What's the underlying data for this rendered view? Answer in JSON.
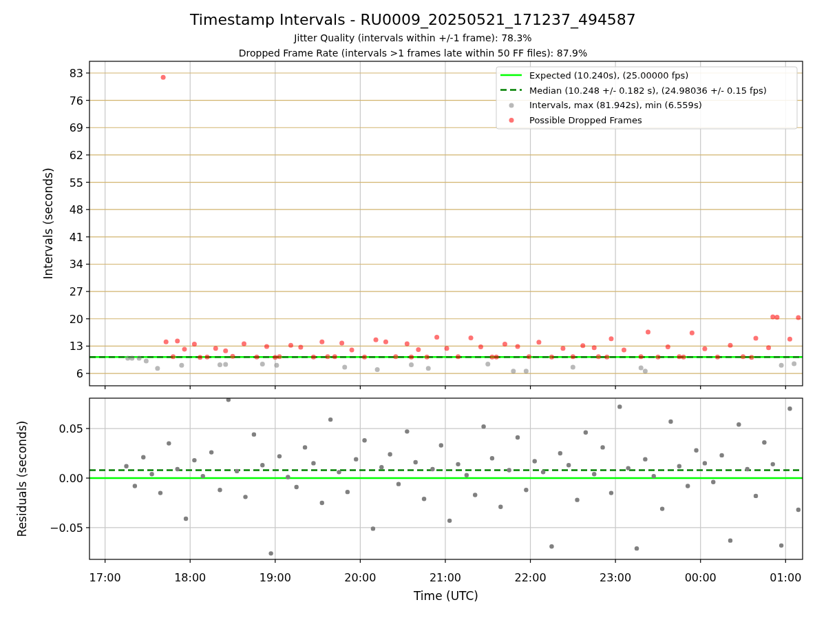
{
  "figure": {
    "title": "Timestamp Intervals - RU0009_20250521_171237_494587",
    "subtitles": [
      "Jitter Quality (intervals within +/-1 frame): 78.3%",
      "Dropped Frame Rate (intervals >1 frames late within 50 FF files): 87.9%"
    ]
  },
  "intervals_panel": {
    "chart_data": {
      "type": "scatter",
      "ylabel": "Intervals (seconds)",
      "xlim": [
        "2025-05-21 16:49",
        "2025-05-22 01:12"
      ],
      "ylim": [
        2.83,
        86.0
      ],
      "yticks": [
        6,
        13,
        20,
        27,
        34,
        41,
        48,
        55,
        62,
        69,
        76,
        83
      ],
      "series": [
        {
          "name": "Intervals, max (81.942s), min (6.559s)",
          "color": "#808080",
          "x": [
            "2025-05-21 17:16",
            "2025-05-21 17:19",
            "2025-05-21 17:24",
            "2025-05-21 17:29",
            "2025-05-21 17:37",
            "2025-05-21 17:54",
            "2025-05-21 18:21",
            "2025-05-21 18:25",
            "2025-05-21 18:51",
            "2025-05-21 19:01",
            "2025-05-21 19:49",
            "2025-05-21 20:12",
            "2025-05-21 20:36",
            "2025-05-21 20:48",
            "2025-05-21 21:30",
            "2025-05-21 21:48",
            "2025-05-21 21:57",
            "2025-05-21 22:30",
            "2025-05-21 23:18",
            "2025-05-21 23:21",
            "2025-05-22 00:57",
            "2025-05-22 01:06"
          ],
          "values": [
            9.9,
            9.9,
            9.9,
            9.2,
            7.3,
            8.1,
            8.2,
            8.3,
            8.4,
            8.1,
            7.6,
            7.0,
            8.2,
            7.3,
            8.4,
            6.6,
            6.6,
            7.6,
            7.4,
            6.6,
            8.1,
            8.5
          ]
        },
        {
          "name": "Possible Dropped Frames",
          "color": "#ff0000",
          "x": [
            "2025-05-21 17:41",
            "2025-05-21 17:43",
            "2025-05-21 17:51",
            "2025-05-21 17:56",
            "2025-05-21 18:03",
            "2025-05-21 18:07",
            "2025-05-21 18:18",
            "2025-05-21 18:25",
            "2025-05-21 18:30",
            "2025-05-21 18:38",
            "2025-05-21 18:47",
            "2025-05-21 18:54",
            "2025-05-21 19:03",
            "2025-05-21 19:11",
            "2025-05-21 19:18",
            "2025-05-21 19:27",
            "2025-05-21 19:33",
            "2025-05-21 19:37",
            "2025-05-21 19:47",
            "2025-05-21 19:54",
            "2025-05-21 20:03",
            "2025-05-21 20:11",
            "2025-05-21 20:18",
            "2025-05-21 20:25",
            "2025-05-21 20:33",
            "2025-05-21 20:41",
            "2025-05-21 20:47",
            "2025-05-21 20:54",
            "2025-05-21 21:01",
            "2025-05-21 21:09",
            "2025-05-21 21:18",
            "2025-05-21 21:25",
            "2025-05-21 21:33",
            "2025-05-21 21:42",
            "2025-05-21 21:51",
            "2025-05-21 21:59",
            "2025-05-21 22:06",
            "2025-05-21 22:15",
            "2025-05-21 22:23",
            "2025-05-21 22:30",
            "2025-05-21 22:37",
            "2025-05-21 22:45",
            "2025-05-21 22:54",
            "2025-05-21 22:57",
            "2025-05-21 23:06",
            "2025-05-21 23:18",
            "2025-05-21 23:23",
            "2025-05-21 23:30",
            "2025-05-21 23:37",
            "2025-05-21 23:45",
            "2025-05-21 23:54",
            "2025-05-22 00:03",
            "2025-05-22 00:12",
            "2025-05-22 00:21",
            "2025-05-22 00:30",
            "2025-05-22 00:39",
            "2025-05-22 00:48",
            "2025-05-22 00:51",
            "2025-05-22 00:54",
            "2025-05-22 01:03",
            "2025-05-22 01:09",
            "2025-05-21 17:48",
            "2025-05-21 18:12",
            "2025-05-21 19:00",
            "2025-05-21 19:42",
            "2025-05-21 20:36",
            "2025-05-21 21:36",
            "2025-05-21 22:48",
            "2025-05-21 23:48",
            "2025-05-22 00:36"
          ],
          "values": [
            81.9,
            14.1,
            14.3,
            12.2,
            13.5,
            10.1,
            12.4,
            11.8,
            10.4,
            13.6,
            10.2,
            12.9,
            10.3,
            13.2,
            12.7,
            10.2,
            14.1,
            10.3,
            13.8,
            12.0,
            10.2,
            14.6,
            14.1,
            10.3,
            13.6,
            12.1,
            10.2,
            15.3,
            12.4,
            10.3,
            15.1,
            12.8,
            10.2,
            13.5,
            12.9,
            10.3,
            14.0,
            10.2,
            12.4,
            10.3,
            13.1,
            12.6,
            10.2,
            14.9,
            12.0,
            10.3,
            16.6,
            10.2,
            12.8,
            10.3,
            16.4,
            12.3,
            10.2,
            13.2,
            10.3,
            15.0,
            12.6,
            20.5,
            20.4,
            14.8,
            20.3,
            10.3,
            10.2,
            10.1,
            10.3,
            10.2,
            10.2,
            10.3,
            10.2,
            10.1
          ]
        }
      ],
      "ref_lines": [
        {
          "axis": "y",
          "value": 10.2,
          "label": "Expected (10.240s), (25.00000 fps)",
          "color": "#00ff00"
        },
        {
          "axis": "y",
          "value": 10.2,
          "label": "Median (10.248 +/- 0.182 s), (24.98036 +/- 0.15 fps)",
          "color": "#008000"
        }
      ],
      "grid": true,
      "legend": true
    }
  },
  "residuals_panel": {
    "chart_data": {
      "type": "scatter",
      "xlabel": "Time (UTC)",
      "ylabel": "Residuals (seconds)",
      "xlim": [
        "2025-05-21 16:49",
        "2025-05-22 01:12"
      ],
      "ylim": [
        -0.082,
        0.0806
      ],
      "xticks": [
        {
          "value": "2025-05-21 17:00",
          "label": "17:00"
        },
        {
          "value": "2025-05-21 18:00",
          "label": "18:00"
        },
        {
          "value": "2025-05-21 19:00",
          "label": "19:00"
        },
        {
          "value": "2025-05-21 20:00",
          "label": "20:00"
        },
        {
          "value": "2025-05-21 21:00",
          "label": "21:00"
        },
        {
          "value": "2025-05-21 22:00",
          "label": "22:00"
        },
        {
          "value": "2025-05-21 23:00",
          "label": "23:00"
        },
        {
          "value": "2025-05-22 00:00",
          "label": "00:00"
        },
        {
          "value": "2025-05-22 01:00",
          "label": "01:00"
        }
      ],
      "yticks": [
        {
          "value": -0.05,
          "label": "−0.05"
        },
        {
          "value": 0,
          "label": "0.00"
        },
        {
          "value": 0.05,
          "label": "0.05"
        }
      ],
      "series": [
        {
          "color": "#808080",
          "x": [
            "2025-05-21 17:15",
            "2025-05-21 17:21",
            "2025-05-21 17:27",
            "2025-05-21 17:33",
            "2025-05-21 17:39",
            "2025-05-21 17:45",
            "2025-05-21 17:51",
            "2025-05-21 17:57",
            "2025-05-21 18:03",
            "2025-05-21 18:09",
            "2025-05-21 18:15",
            "2025-05-21 18:21",
            "2025-05-21 18:27",
            "2025-05-21 18:33",
            "2025-05-21 18:39",
            "2025-05-21 18:45",
            "2025-05-21 18:51",
            "2025-05-21 18:57",
            "2025-05-21 19:03",
            "2025-05-21 19:09",
            "2025-05-21 19:15",
            "2025-05-21 19:21",
            "2025-05-21 19:27",
            "2025-05-21 19:33",
            "2025-05-21 19:39",
            "2025-05-21 19:45",
            "2025-05-21 19:51",
            "2025-05-21 19:57",
            "2025-05-21 20:03",
            "2025-05-21 20:09",
            "2025-05-21 20:15",
            "2025-05-21 20:21",
            "2025-05-21 20:27",
            "2025-05-21 20:33",
            "2025-05-21 20:39",
            "2025-05-21 20:45",
            "2025-05-21 20:51",
            "2025-05-21 20:57",
            "2025-05-21 21:03",
            "2025-05-21 21:09",
            "2025-05-21 21:15",
            "2025-05-21 21:21",
            "2025-05-21 21:27",
            "2025-05-21 21:33",
            "2025-05-21 21:39",
            "2025-05-21 21:45",
            "2025-05-21 21:51",
            "2025-05-21 21:57",
            "2025-05-21 22:03",
            "2025-05-21 22:09",
            "2025-05-21 22:15",
            "2025-05-21 22:21",
            "2025-05-21 22:27",
            "2025-05-21 22:33",
            "2025-05-21 22:39",
            "2025-05-21 22:45",
            "2025-05-21 22:51",
            "2025-05-21 22:57",
            "2025-05-21 23:03",
            "2025-05-21 23:09",
            "2025-05-21 23:15",
            "2025-05-21 23:21",
            "2025-05-21 23:27",
            "2025-05-21 23:33",
            "2025-05-21 23:39",
            "2025-05-21 23:45",
            "2025-05-21 23:51",
            "2025-05-21 23:57",
            "2025-05-22 00:03",
            "2025-05-22 00:09",
            "2025-05-22 00:15",
            "2025-05-22 00:21",
            "2025-05-22 00:27",
            "2025-05-22 00:33",
            "2025-05-22 00:39",
            "2025-05-22 00:45",
            "2025-05-22 00:51",
            "2025-05-22 00:57",
            "2025-05-22 01:03",
            "2025-05-22 01:09"
          ],
          "values": [
            0.012,
            -0.008,
            0.021,
            0.004,
            -0.015,
            0.035,
            0.009,
            -0.041,
            0.018,
            0.002,
            0.026,
            -0.012,
            0.079,
            0.007,
            -0.019,
            0.044,
            0.013,
            -0.076,
            0.022,
            0.001,
            -0.009,
            0.031,
            0.015,
            -0.025,
            0.059,
            0.006,
            -0.014,
            0.019,
            0.038,
            -0.051,
            0.011,
            0.024,
            -0.006,
            0.047,
            0.016,
            -0.021,
            0.009,
            0.033,
            -0.043,
            0.014,
            0.003,
            -0.017,
            0.052,
            0.02,
            -0.029,
            0.008,
            0.041,
            -0.012,
            0.017,
            0.006,
            -0.069,
            0.025,
            0.013,
            -0.022,
            0.046,
            0.004,
            0.031,
            -0.015,
            0.072,
            0.01,
            -0.071,
            0.019,
            0.002,
            -0.031,
            0.057,
            0.012,
            -0.008,
            0.028,
            0.015,
            -0.004,
            0.023,
            -0.063,
            0.054,
            0.009,
            -0.018,
            0.036,
            0.014,
            -0.068,
            0.07,
            -0.032
          ]
        }
      ],
      "ref_lines": [
        {
          "axis": "y",
          "value": 0,
          "color": "#00ff00"
        },
        {
          "axis": "y",
          "value": 0.008,
          "color": "#008000"
        }
      ],
      "grid": true
    }
  }
}
